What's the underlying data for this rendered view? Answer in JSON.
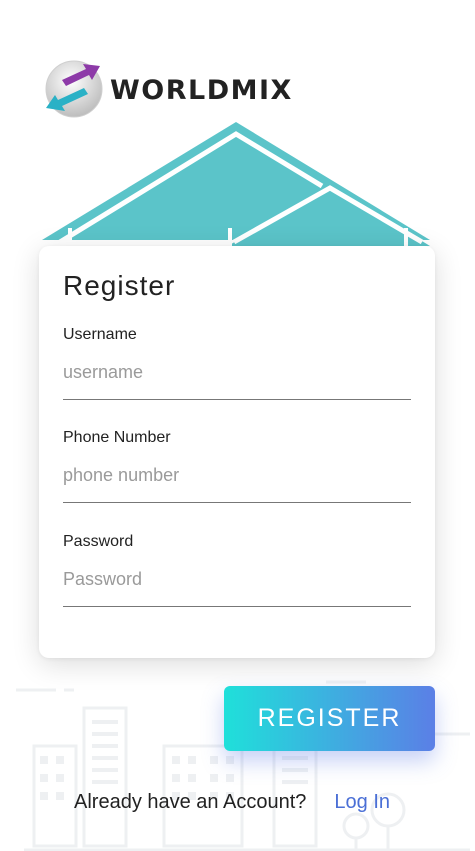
{
  "brand": {
    "name": "WORLDMIX",
    "icon": "worldmix-logo-icon"
  },
  "colors": {
    "roof": "#5bc4c9",
    "accent_start": "#1fe0da",
    "accent_end": "#5b7fe6",
    "link": "#4a6fd6"
  },
  "form": {
    "title": "Register",
    "fields": [
      {
        "label": "Username",
        "placeholder": "username",
        "value": ""
      },
      {
        "label": "Phone Number",
        "placeholder": "phone number",
        "value": ""
      },
      {
        "label": "Password",
        "placeholder": "Password",
        "value": ""
      }
    ],
    "submit_label": "REGISTER"
  },
  "footer": {
    "prompt": "Already have an Account?",
    "link_label": "Log In"
  }
}
